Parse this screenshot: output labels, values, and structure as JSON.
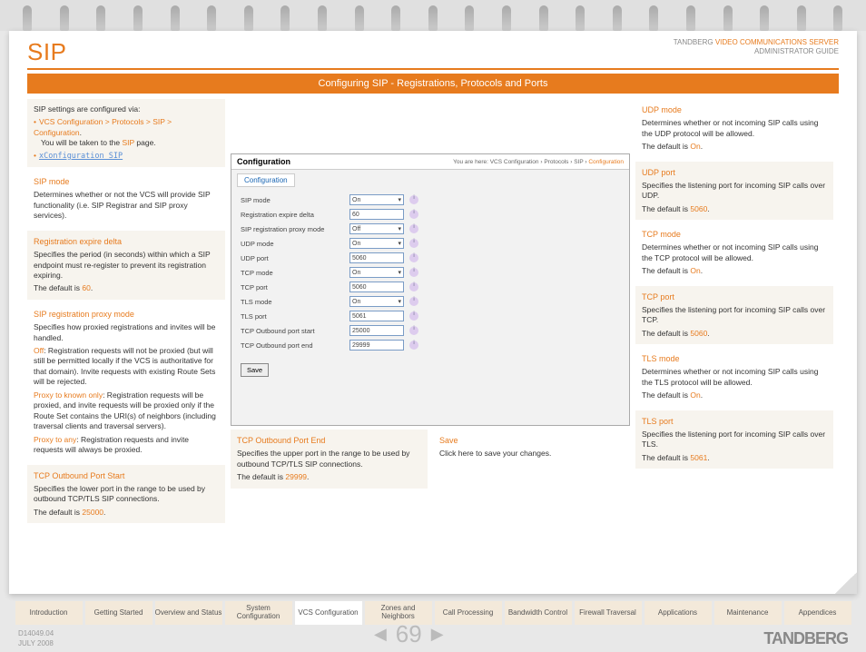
{
  "header": {
    "title": "SIP",
    "brand_line1_a": "TANDBERG ",
    "brand_line1_b": "VIDEO COMMUNICATIONS SERVER",
    "brand_line2": "ADMINISTRATOR GUIDE"
  },
  "banner": "Configuring SIP - Registrations, Protocols and Ports",
  "intro": {
    "line1": "SIP settings are configured via:",
    "path": "VCS Configuration > Protocols > SIP > Configuration",
    "line2a": "You will be  taken to the ",
    "line2_link": "SIP",
    "line2b": " page.",
    "xlink": "xConfiguration SIP"
  },
  "left": [
    {
      "h": "SIP mode",
      "body": "Determines whether or not the VCS will provide SIP functionality (i.e. SIP Registrar and SIP proxy services)."
    },
    {
      "h": "Registration expire delta",
      "body": "Specifies the period (in seconds) within which a SIP endpoint must re-register to prevent its registration expiring.",
      "def": "The default is ",
      "defv": "60",
      "deft": "."
    },
    {
      "h": "SIP registration proxy mode",
      "body": "Specifies how proxied registrations and invites will be handled.",
      "p1a": "Off",
      "p1b": ": Registration requests will not be proxied (but will still be permitted locally if the VCS is authoritative for that domain).  Invite requests with existing Route Sets will be rejected.",
      "p2a": "Proxy to known only",
      "p2b": ": Registration requests will be proxied, and invite requests will be proxied only if the Route Set contains the URI(s) of neighbors (including traversal clients and traversal servers).",
      "p3a": "Proxy to any",
      "p3b": ":  Registration requests and invite requests will always be proxied."
    },
    {
      "h": "TCP Outbound Port Start",
      "body": "Specifies the lower port in the range to be used by outbound TCP/TLS SIP connections.",
      "def": "The default is ",
      "defv": "25000",
      "deft": "."
    }
  ],
  "right": [
    {
      "h": "UDP mode",
      "body": "Determines whether or not incoming SIP calls using the UDP protocol will be allowed.",
      "def": "The default is ",
      "defv": "On",
      "deft": "."
    },
    {
      "h": "UDP port",
      "body": "Specifies the listening port for incoming SIP calls over UDP.",
      "def": "The default is ",
      "defv": "5060",
      "deft": "."
    },
    {
      "h": "TCP mode",
      "body": "Determines whether or not incoming SIP calls using the TCP protocol will be allowed.",
      "def": "The default is ",
      "defv": "On",
      "deft": "."
    },
    {
      "h": "TCP port",
      "body": "Specifies the listening port for incoming SIP calls over TCP.",
      "def": "The default is ",
      "defv": "5060",
      "deft": "."
    },
    {
      "h": "TLS mode",
      "body": "Determines whether or not incoming SIP calls using the TLS protocol will be allowed.",
      "def": "The default is ",
      "defv": "On",
      "deft": "."
    },
    {
      "h": "TLS port",
      "body": "Specifies the listening port for incoming SIP calls over TLS.",
      "def": "The default is ",
      "defv": "5061",
      "deft": "."
    }
  ],
  "mid_bottom": [
    {
      "h": "TCP Outbound Port End",
      "body": "Specifies the upper port in the range to be used by outbound TCP/TLS SIP connections.",
      "def": "The default is ",
      "defv": "29999",
      "deft": "."
    },
    {
      "h": "Save",
      "body": "Click here to save your changes."
    }
  ],
  "config": {
    "title": "Configuration",
    "crumb_pre": "You are here: VCS Configuration › Protocols › SIP › ",
    "crumb_cur": "Configuration",
    "tab": "Configuration",
    "rows": [
      {
        "lbl": "SIP mode",
        "val": "On",
        "type": "sel"
      },
      {
        "lbl": "Registration expire delta",
        "val": "60",
        "type": "txt"
      },
      {
        "lbl": "SIP registration proxy mode",
        "val": "Off",
        "type": "sel"
      },
      {
        "lbl": "UDP mode",
        "val": "On",
        "type": "sel"
      },
      {
        "lbl": "UDP port",
        "val": "5060",
        "type": "txt"
      },
      {
        "lbl": "TCP mode",
        "val": "On",
        "type": "sel"
      },
      {
        "lbl": "TCP port",
        "val": "5060",
        "type": "txt"
      },
      {
        "lbl": "TLS mode",
        "val": "On",
        "type": "sel"
      },
      {
        "lbl": "TLS port",
        "val": "5061",
        "type": "txt"
      },
      {
        "lbl": "TCP Outbound port start",
        "val": "25000",
        "type": "txt"
      },
      {
        "lbl": "TCP Outbound port end",
        "val": "29999",
        "type": "txt"
      }
    ],
    "save": "Save"
  },
  "tabs": [
    "Introduction",
    "Getting Started",
    "Overview and Status",
    "System Configuration",
    "VCS Configuration",
    "Zones and Neighbors",
    "Call Processing",
    "Bandwidth Control",
    "Firewall Traversal",
    "Applications",
    "Maintenance",
    "Appendices"
  ],
  "active_tab": 4,
  "footer": {
    "doc1": "D14049.04",
    "doc2": "JULY 2008",
    "page": "69",
    "brand": "TANDBERG"
  }
}
